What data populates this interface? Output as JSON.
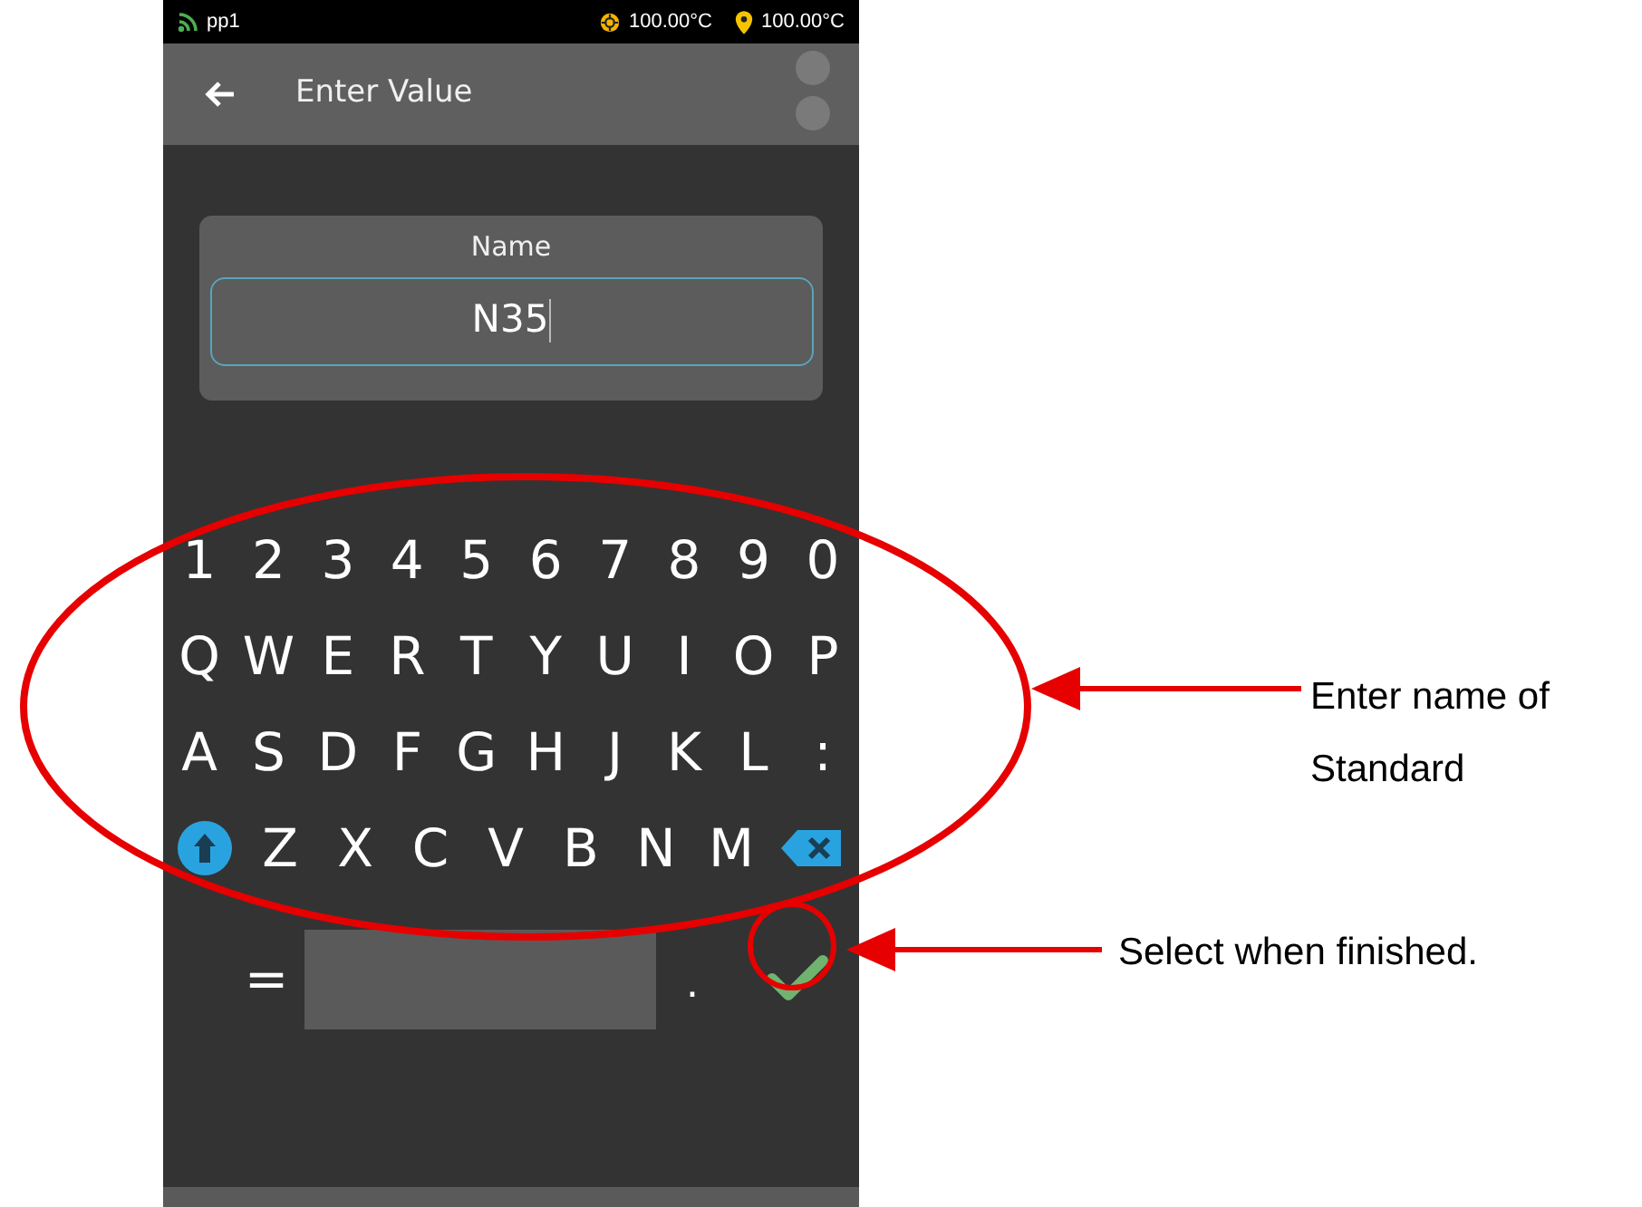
{
  "status_bar": {
    "network": "pp1",
    "readings": [
      "100.00°C",
      "100.00°C"
    ]
  },
  "header": {
    "title": "Enter Value"
  },
  "name_card": {
    "label": "Name",
    "value": "N35"
  },
  "keyboard": {
    "rows": [
      [
        "1",
        "2",
        "3",
        "4",
        "5",
        "6",
        "7",
        "8",
        "9",
        "0"
      ],
      [
        "Q",
        "W",
        "E",
        "R",
        "T",
        "Y",
        "U",
        "I",
        "O",
        "P"
      ],
      [
        "A",
        "S",
        "D",
        "F",
        "G",
        "H",
        "J",
        "K",
        "L",
        ":"
      ]
    ],
    "shift_row_letters": [
      "Z",
      "X",
      "C",
      "V",
      "B",
      "N",
      "M"
    ],
    "bottom_row": {
      "left_key": "=",
      "right_key": "."
    }
  },
  "annotations": [
    "Enter name of Standard",
    "Select when finished."
  ]
}
